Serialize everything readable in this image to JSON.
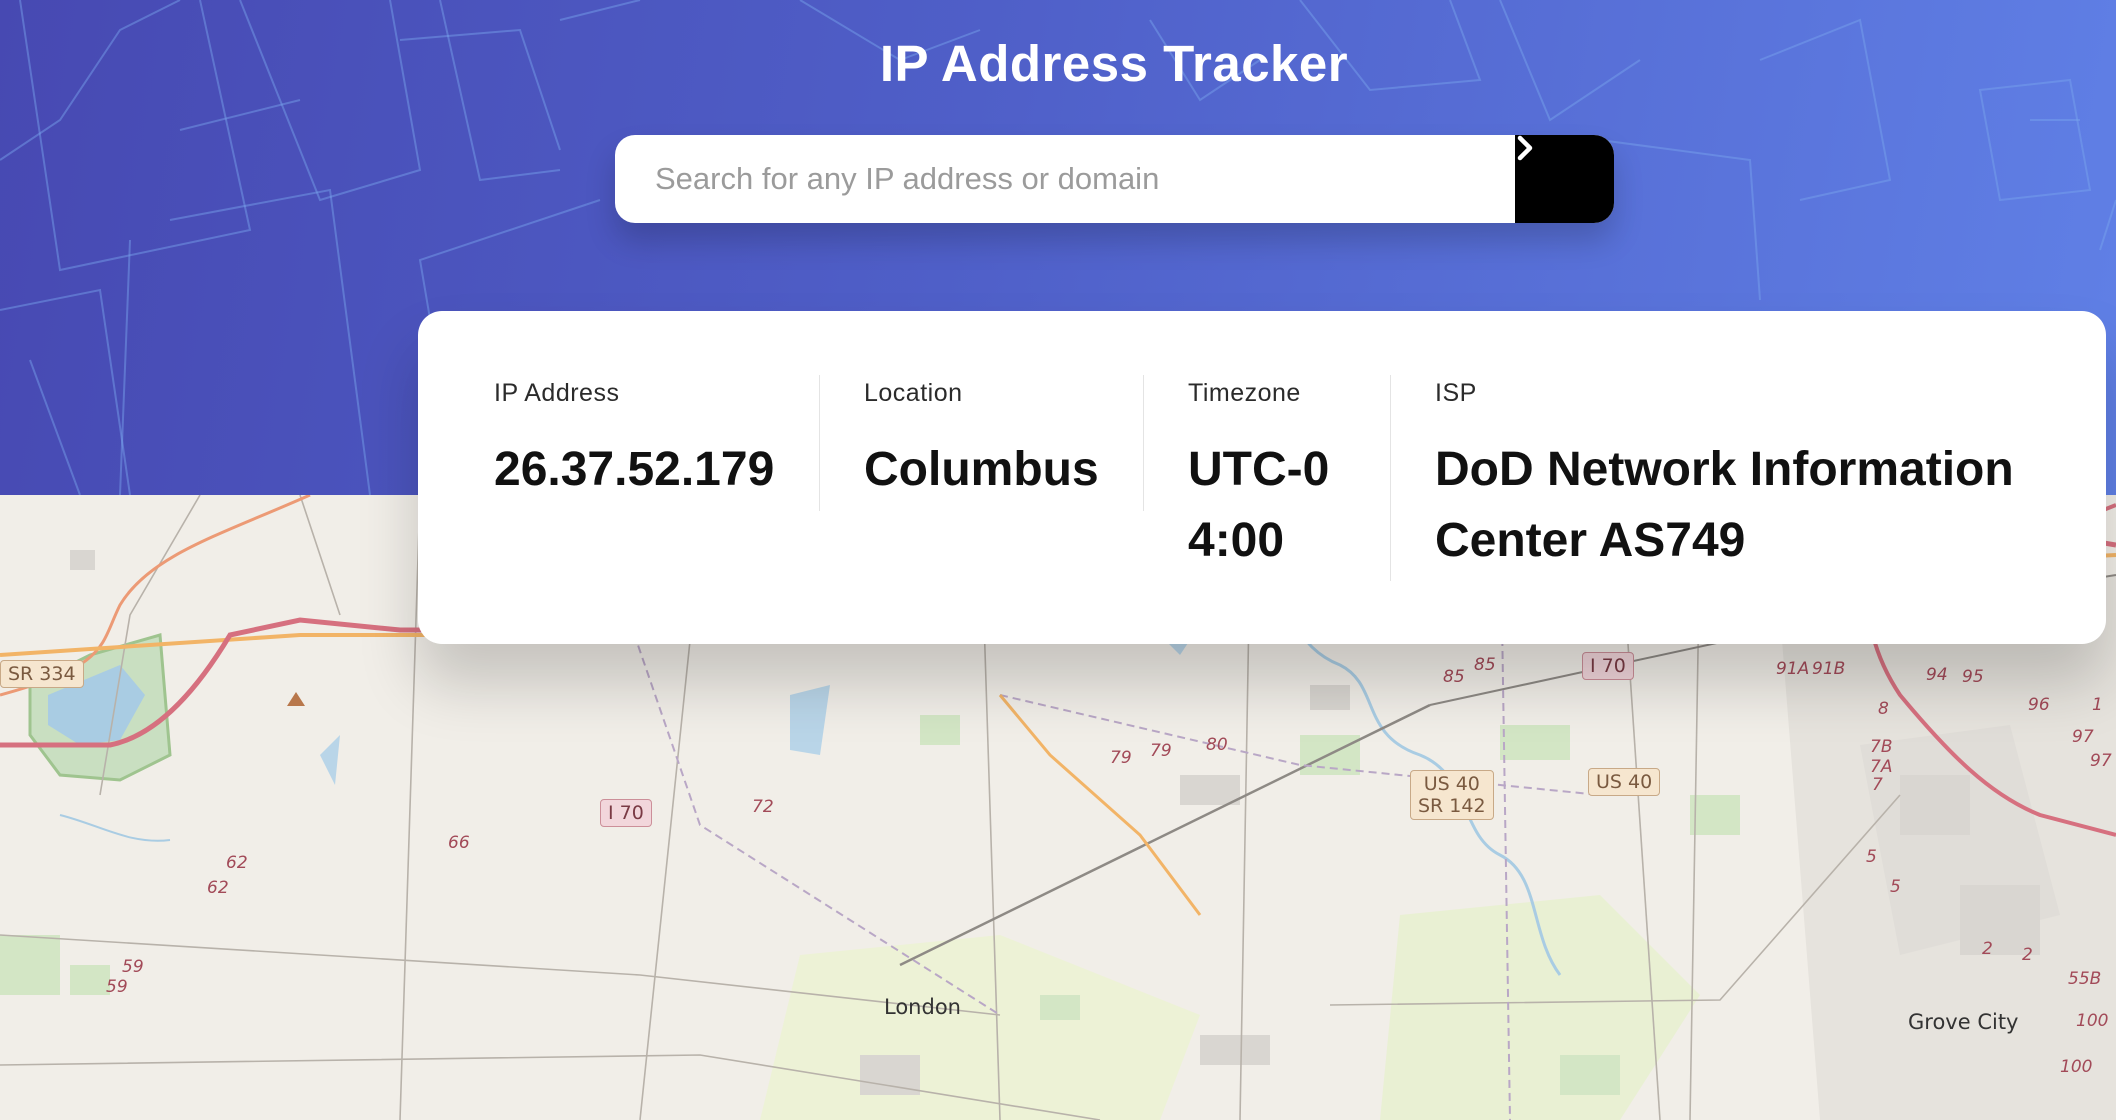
{
  "app": {
    "title": "IP Address Tracker"
  },
  "search": {
    "placeholder": "Search for any IP address or domain",
    "value": ""
  },
  "info": [
    {
      "label": "IP Address",
      "value": "26.37.52.179"
    },
    {
      "label": "Location",
      "value": "Columbus"
    },
    {
      "label": "Timezone",
      "value": "UTC-04:00"
    },
    {
      "label": "ISP",
      "value": "DoD Network Information Center AS749"
    }
  ],
  "map": {
    "places": {
      "london": "London",
      "grove_city": "Grove City"
    },
    "shields": {
      "sr334": "SR 334",
      "i70_west": "I 70",
      "i70_east": "I 70",
      "us40_sr142": [
        "US 40",
        "SR 142"
      ],
      "us40": "US 40"
    },
    "exits": [
      "66",
      "72",
      "62",
      "62",
      "59",
      "59",
      "79",
      "79",
      "80",
      "85",
      "85",
      "91A",
      "91B",
      "8",
      "7B",
      "7A",
      "7",
      "94",
      "95",
      "96",
      "97",
      "97",
      "5",
      "5",
      "2",
      "2",
      "55B",
      "100",
      "100",
      "1"
    ]
  },
  "colors": {
    "header_start": "#4749b2",
    "header_end": "#6080e6",
    "button": "#000000"
  },
  "icons": {
    "submit": "chevron-right-icon"
  }
}
